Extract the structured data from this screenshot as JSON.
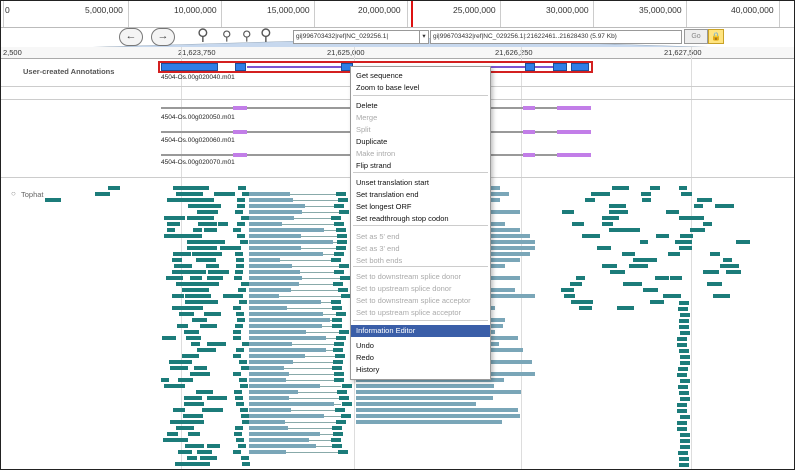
{
  "overview_ruler": {
    "ticks": [
      "0",
      "5,000,000",
      "10,000,000",
      "15,000,000",
      "20,000,000",
      "25,000,000",
      "30,000,000",
      "35,000,000",
      "40,000,000"
    ]
  },
  "toolbar": {
    "back_icon": "arrow-left-icon",
    "forward_icon": "arrow-right-icon",
    "zoom_out_large_icon": "zoom-out-icon",
    "zoom_out_small_icon": "zoom-out-small-icon",
    "zoom_in_small_icon": "zoom-in-small-icon",
    "zoom_in_large_icon": "zoom-in-icon",
    "reference_select": "gi|996703432|ref|NC_029256.1|",
    "location_value": "gi|996703432|ref|NC_029256.1|:21622461..21628430 (5.97 Kb)",
    "go_label": "Go",
    "lock_icon": "lock-icon"
  },
  "detail_ruler": {
    "ticks": [
      "2,500",
      "21,623,750",
      "21,625,000",
      "21,626,250",
      "21,627,500"
    ]
  },
  "tracks": {
    "annotations_label": "User-created Annotations",
    "tophat_label": "Tophat"
  },
  "genes": [
    "4504-Os.00g020040.m01",
    "4504-Os.00g020050.m01",
    "4504-Os.00g020060.m01",
    "4504-Os.00g020070.m01"
  ],
  "context_menu": {
    "items": [
      {
        "label": "Get sequence",
        "enabled": true
      },
      {
        "label": "Zoom to base level",
        "enabled": true
      },
      {
        "label": "Delete",
        "enabled": true
      },
      {
        "label": "Merge",
        "enabled": false
      },
      {
        "label": "Split",
        "enabled": false
      },
      {
        "label": "Duplicate",
        "enabled": true
      },
      {
        "label": "Make intron",
        "enabled": false
      },
      {
        "label": "Flip strand",
        "enabled": true
      },
      {
        "label": "Unset translation start",
        "enabled": true
      },
      {
        "label": "Set translation end",
        "enabled": true
      },
      {
        "label": "Set longest ORF",
        "enabled": true
      },
      {
        "label": "Set readthrough stop codon",
        "enabled": true
      },
      {
        "label": "Set as 5' end",
        "enabled": false
      },
      {
        "label": "Set as 3' end",
        "enabled": false
      },
      {
        "label": "Set both ends",
        "enabled": false
      },
      {
        "label": "Set to downstream splice donor",
        "enabled": false
      },
      {
        "label": "Set to upstream splice donor",
        "enabled": false
      },
      {
        "label": "Set to downstream splice acceptor",
        "enabled": false
      },
      {
        "label": "Set to upstream splice acceptor",
        "enabled": false
      },
      {
        "label": "Information Editor",
        "enabled": true,
        "highlighted": true
      },
      {
        "label": "Undo",
        "enabled": true
      },
      {
        "label": "Redo",
        "enabled": true
      },
      {
        "label": "History",
        "enabled": true
      }
    ]
  },
  "colors": {
    "exon": "#2e7ee6",
    "intron": "#7b56d0",
    "read": "#1c7c7a",
    "selection": "#d32020",
    "menu_highlight": "#3a5ea8"
  }
}
